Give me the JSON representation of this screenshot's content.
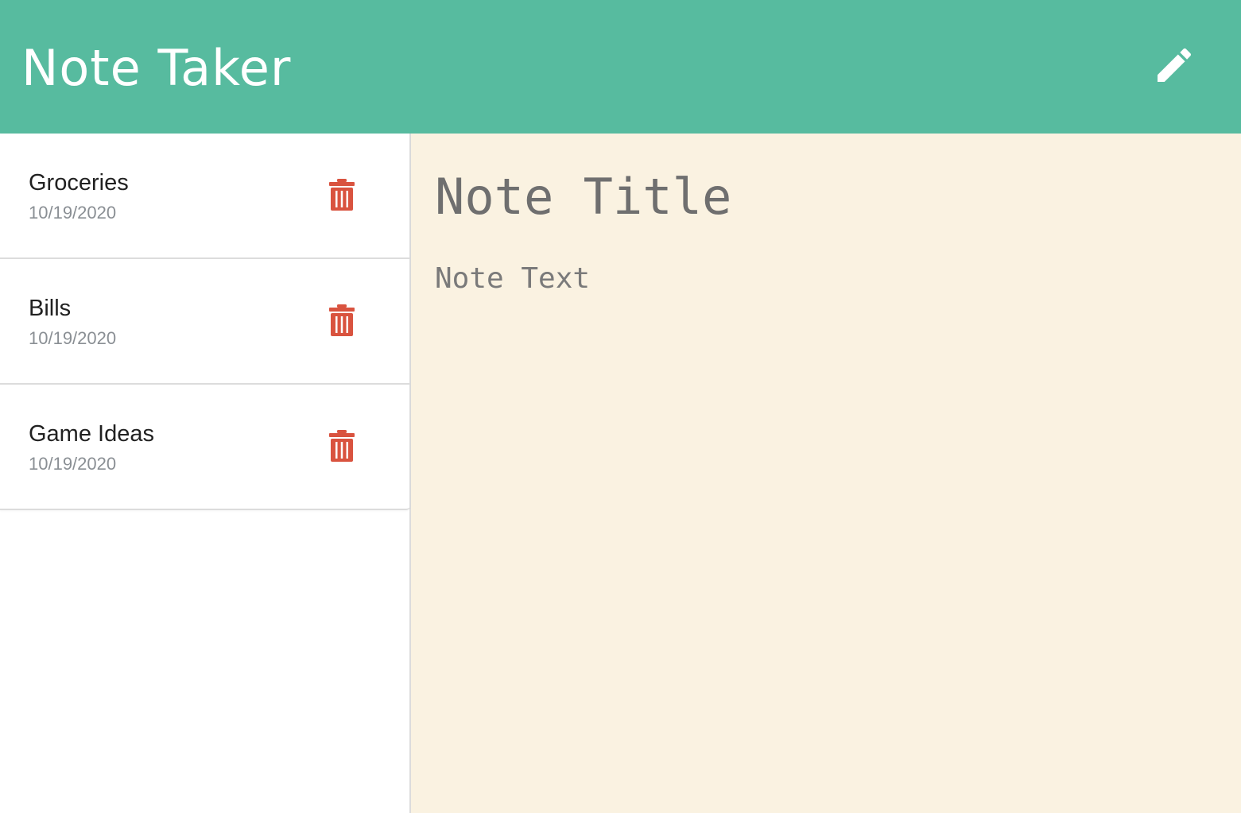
{
  "app": {
    "title": "Note Taker",
    "new_note_icon": "pencil-icon"
  },
  "colors": {
    "navbar": "#57bb9f",
    "editor_background": "#faf2e1",
    "delete_icon": "#d9533f",
    "sidebar_background": "#ffffff"
  },
  "notes": [
    {
      "title": "Groceries",
      "date": "10/19/2020",
      "icon": "trash-icon"
    },
    {
      "title": "Bills",
      "date": "10/19/2020",
      "icon": "trash-icon"
    },
    {
      "title": "Game Ideas",
      "date": "10/19/2020",
      "icon": "trash-icon"
    }
  ],
  "editor": {
    "title_placeholder": "Note Title",
    "title_value": "",
    "text_placeholder": "Note Text",
    "text_value": ""
  }
}
